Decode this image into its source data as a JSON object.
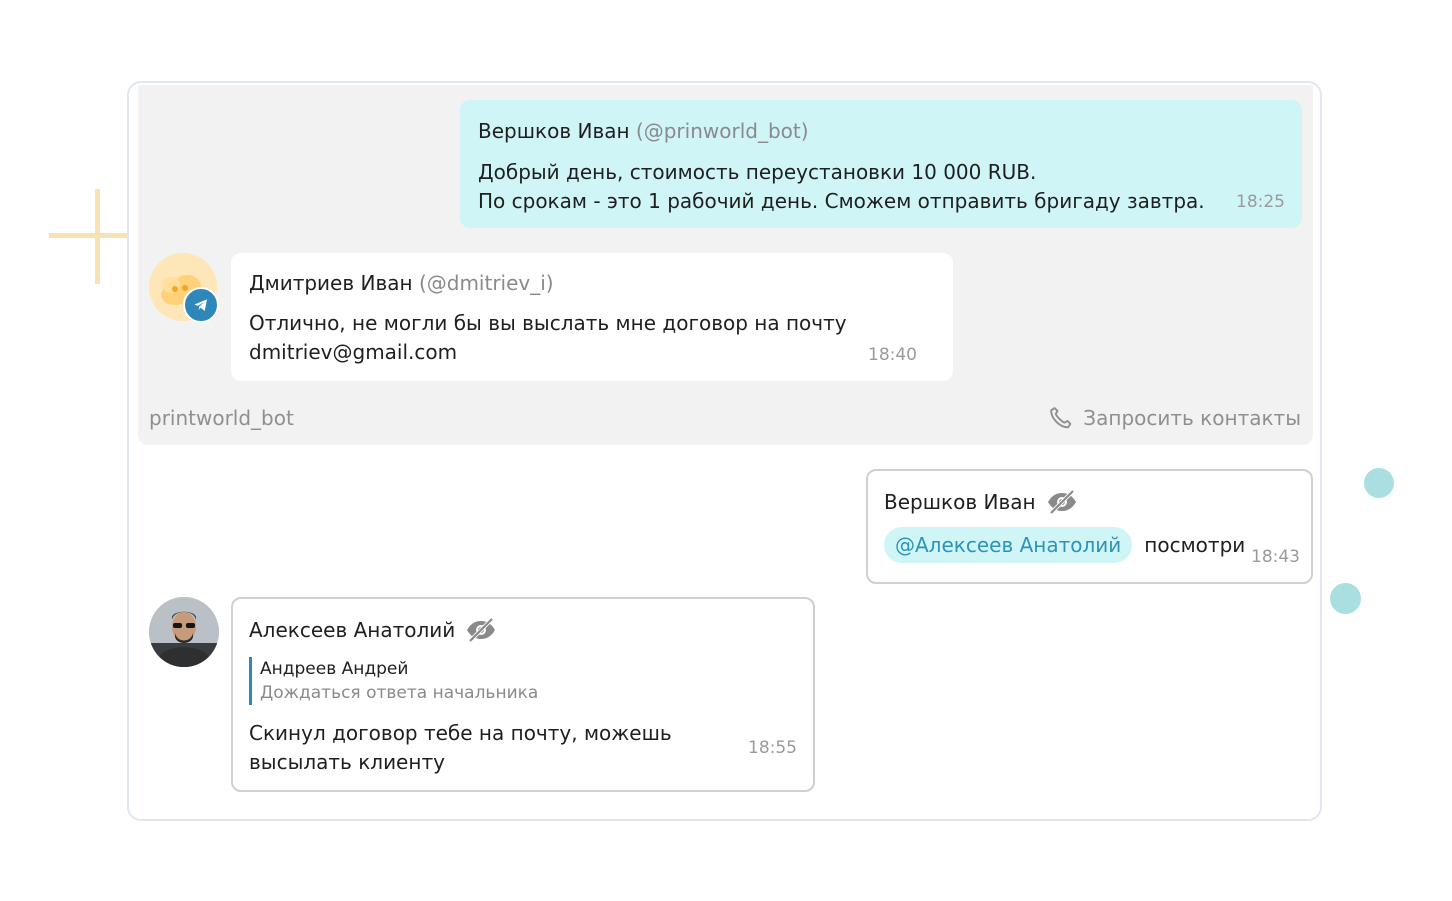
{
  "bot_panel": {
    "bot_name": "printworld_bot",
    "request_contacts_label": "Запросить контакты"
  },
  "messages": [
    {
      "author": "Вершков Иван",
      "handle": "(@prinworld_bot)",
      "lines": [
        "Добрый день, стоимость переустановки 10 000 RUB.",
        "По срокам - это 1 рабочий день. Сможем отправить бригаду завтра."
      ],
      "time": "18:25"
    },
    {
      "author": "Дмитриев Иван",
      "handle": "(@dmitriev_i)",
      "lines": [
        "Отлично, не могли бы вы выслать мне договор на почту",
        "dmitriev@gmail.com"
      ],
      "time": "18:40"
    },
    {
      "author": "Вершков Иван",
      "mention": "@Алексеев Анатолий",
      "text": "посмотри",
      "time": "18:43"
    },
    {
      "author": "Алексеев Анатолий",
      "quote_author": "Андреев Андрей",
      "quote_text": "Дождаться ответа начальника",
      "text": "Скинул договор тебе на почту, можешь высылать клиенту",
      "time": "18:55"
    }
  ],
  "icons": {
    "hidden": "eye-off-icon",
    "phone": "phone-icon",
    "telegram": "telegram-icon"
  },
  "colors": {
    "accent": "#2f86b9",
    "outgoing_bubble": "#cff5f7",
    "mention_text": "#2f93b8"
  }
}
